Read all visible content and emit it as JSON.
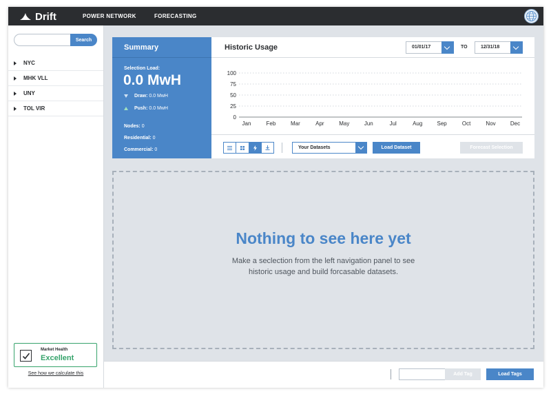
{
  "app": {
    "brand": "Drift"
  },
  "nav": [
    {
      "label": "POWER NETWORK"
    },
    {
      "label": "FORECASTING"
    }
  ],
  "sidebar": {
    "search_placeholder": "",
    "search_label": "Search",
    "items": [
      {
        "label": "NYC"
      },
      {
        "label": "MHK VLL"
      },
      {
        "label": "UNY"
      },
      {
        "label": "TOL VIR"
      }
    ],
    "market_health": {
      "label": "Market Health",
      "value": "Excellent"
    },
    "calc_link": "See how we calculate this"
  },
  "summary": {
    "title": "Summary",
    "selection_label": "Selection Load:",
    "selection_value": "0.0 MwH",
    "draw_label": "Draw:",
    "draw_value": "0.0 MwH",
    "push_label": "Push:",
    "push_value": "0.0 MwH",
    "nodes_label": "Nodes:",
    "nodes_value": "0",
    "residential_label": "Residential:",
    "residential_value": "0",
    "commercial_label": "Commercial:",
    "commercial_value": "0"
  },
  "historic": {
    "title": "Historic Usage",
    "from_date": "01/01/17",
    "to_label": "TO",
    "to_date": "12/31/18",
    "datasets_label": "Your Datasets",
    "load_dataset": "Load Dataset",
    "forecast_selection": "Forecast Selection",
    "view_icons": [
      "list-view-icon",
      "grid-view-icon",
      "bolt-view-icon",
      "download-icon"
    ]
  },
  "chart_data": {
    "type": "line",
    "categories": [
      "Jan",
      "Feb",
      "Mar",
      "Apr",
      "May",
      "Jun",
      "Jul",
      "Aug",
      "Sep",
      "Oct",
      "Nov",
      "Dec"
    ],
    "series": [],
    "yticks": [
      0,
      25,
      50,
      75,
      100
    ],
    "ylim": [
      0,
      100
    ],
    "grid": true
  },
  "empty_state": {
    "title": "Nothing to see here yet",
    "description": "Make a seclection from the left navigation panel to see historic usage and build forcasable datasets."
  },
  "bottom": {
    "tag_placeholder": "",
    "add_tag": "Add Tag",
    "load_tags": "Load Tags"
  },
  "colors": {
    "accent": "#4a86c8",
    "topbar": "#2b2d30",
    "success": "#36a36b",
    "canvas": "#dfe3e8"
  }
}
